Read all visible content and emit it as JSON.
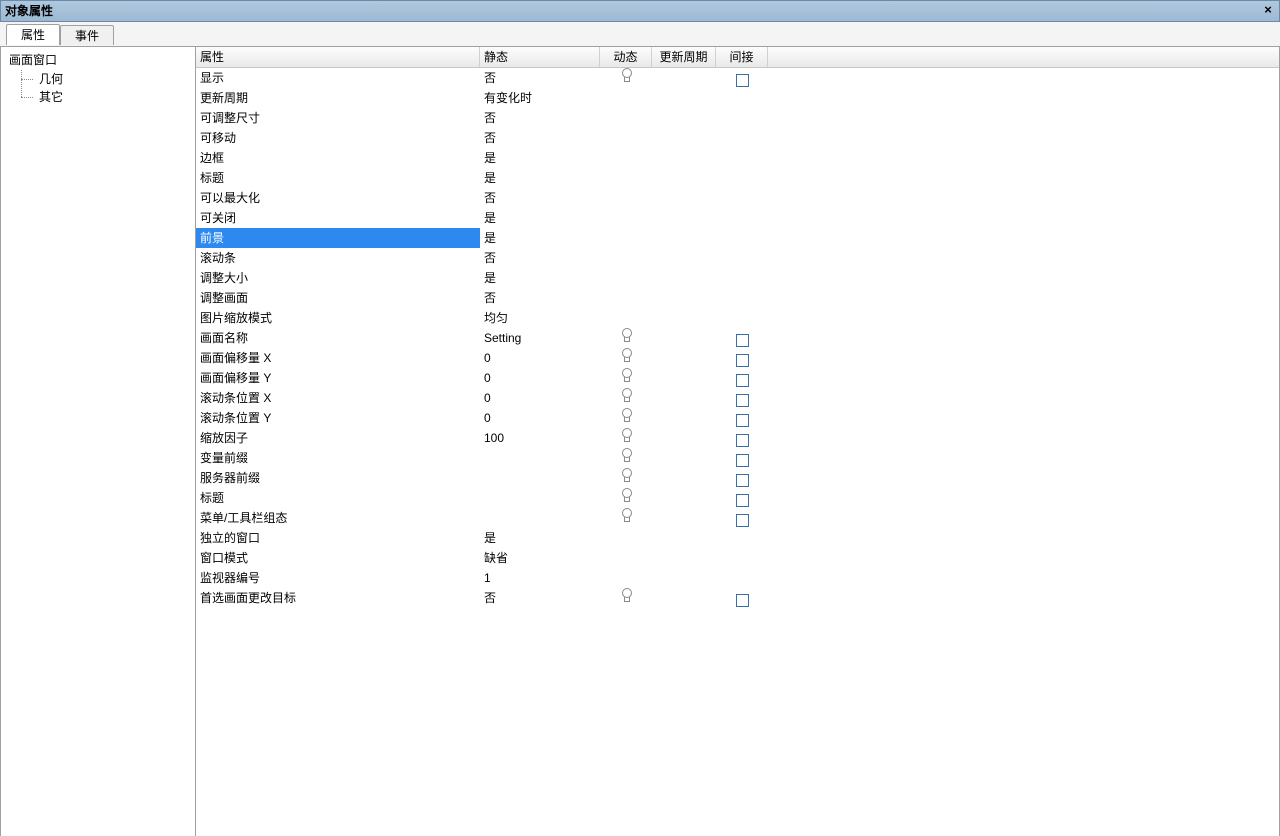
{
  "window": {
    "title": "对象属性",
    "close_glyph": "×"
  },
  "tabs": [
    {
      "label": "属性",
      "active": true
    },
    {
      "label": "事件",
      "active": false
    }
  ],
  "tree": {
    "root": "画面窗口",
    "children": [
      {
        "label": "几何"
      },
      {
        "label": "其它"
      }
    ]
  },
  "columns": {
    "prop": "属性",
    "static_": "静态",
    "dynamic": "动态",
    "update": "更新周期",
    "indirect": "间接"
  },
  "rows": [
    {
      "prop": "显示",
      "static_": "否",
      "bulb": true,
      "chk": true,
      "selected": false
    },
    {
      "prop": "更新周期",
      "static_": "有变化时",
      "bulb": false,
      "chk": false,
      "selected": false
    },
    {
      "prop": "可调整尺寸",
      "static_": "否",
      "bulb": false,
      "chk": false,
      "selected": false
    },
    {
      "prop": "可移动",
      "static_": "否",
      "bulb": false,
      "chk": false,
      "selected": false
    },
    {
      "prop": "边框",
      "static_": "是",
      "bulb": false,
      "chk": false,
      "selected": false
    },
    {
      "prop": "标题",
      "static_": "是",
      "bulb": false,
      "chk": false,
      "selected": false
    },
    {
      "prop": "可以最大化",
      "static_": "否",
      "bulb": false,
      "chk": false,
      "selected": false
    },
    {
      "prop": "可关闭",
      "static_": "是",
      "bulb": false,
      "chk": false,
      "selected": false
    },
    {
      "prop": "前景",
      "static_": "是",
      "bulb": false,
      "chk": false,
      "selected": true
    },
    {
      "prop": "滚动条",
      "static_": "否",
      "bulb": false,
      "chk": false,
      "selected": false
    },
    {
      "prop": "调整大小",
      "static_": "是",
      "bulb": false,
      "chk": false,
      "selected": false
    },
    {
      "prop": "调整画面",
      "static_": "否",
      "bulb": false,
      "chk": false,
      "selected": false
    },
    {
      "prop": "图片缩放模式",
      "static_": "均匀",
      "bulb": false,
      "chk": false,
      "selected": false
    },
    {
      "prop": "画面名称",
      "static_": "Setting",
      "bulb": true,
      "chk": true,
      "selected": false
    },
    {
      "prop": "画面偏移量 X",
      "static_": "0",
      "bulb": true,
      "chk": true,
      "selected": false
    },
    {
      "prop": "画面偏移量 Y",
      "static_": "0",
      "bulb": true,
      "chk": true,
      "selected": false
    },
    {
      "prop": "滚动条位置 X",
      "static_": "0",
      "bulb": true,
      "chk": true,
      "selected": false
    },
    {
      "prop": "滚动条位置 Y",
      "static_": "0",
      "bulb": true,
      "chk": true,
      "selected": false
    },
    {
      "prop": "缩放因子",
      "static_": "100",
      "bulb": true,
      "chk": true,
      "selected": false
    },
    {
      "prop": "变量前缀",
      "static_": "",
      "bulb": true,
      "chk": true,
      "selected": false
    },
    {
      "prop": "服务器前缀",
      "static_": "",
      "bulb": true,
      "chk": true,
      "selected": false
    },
    {
      "prop": "标题",
      "static_": "",
      "bulb": true,
      "chk": true,
      "selected": false
    },
    {
      "prop": "菜单/工具栏组态",
      "static_": "",
      "bulb": true,
      "chk": true,
      "selected": false
    },
    {
      "prop": "独立的窗口",
      "static_": "是",
      "bulb": false,
      "chk": false,
      "selected": false
    },
    {
      "prop": "窗口模式",
      "static_": "缺省",
      "bulb": false,
      "chk": false,
      "selected": false
    },
    {
      "prop": "监视器编号",
      "static_": "1",
      "bulb": false,
      "chk": false,
      "selected": false
    },
    {
      "prop": "首选画面更改目标",
      "static_": "否",
      "bulb": true,
      "chk": true,
      "selected": false
    }
  ]
}
